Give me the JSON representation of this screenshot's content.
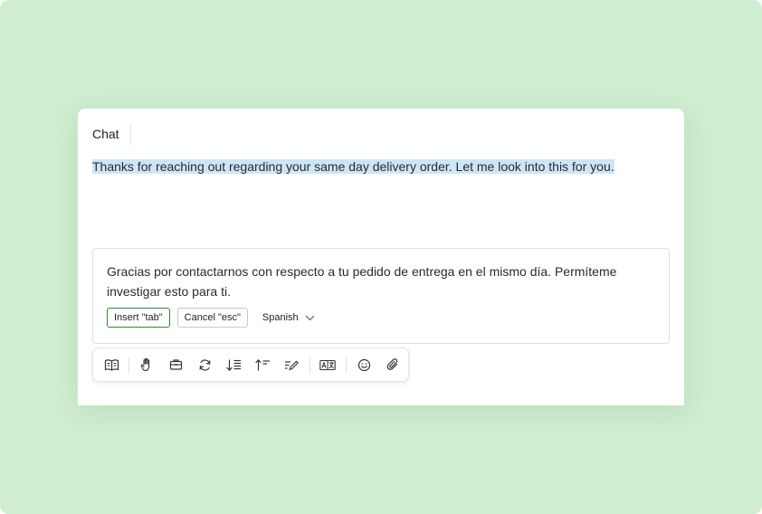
{
  "chat": {
    "tab_label": "Chat",
    "message": "Thanks for reaching out regarding your same day delivery order. Let me look into this for you."
  },
  "translation": {
    "text": "Gracias por contactarnos con respecto a tu pedido de entrega en el mismo día. Permíteme investigar esto para ti.",
    "insert_label": "Insert \"tab\"",
    "cancel_label": "Cancel \"esc\"",
    "language": "Spanish"
  },
  "toolbar": {
    "icons": [
      "knowledge-book-icon",
      "hand-icon",
      "briefcase-icon",
      "refresh-icon",
      "expand-text-icon",
      "shorten-text-icon",
      "rewrite-pen-icon",
      "translate-icon",
      "emoji-icon",
      "attachment-icon"
    ]
  },
  "colors": {
    "background": "#cfedd0",
    "highlight": "#cde6f7",
    "insert_border": "#2f8a34"
  }
}
